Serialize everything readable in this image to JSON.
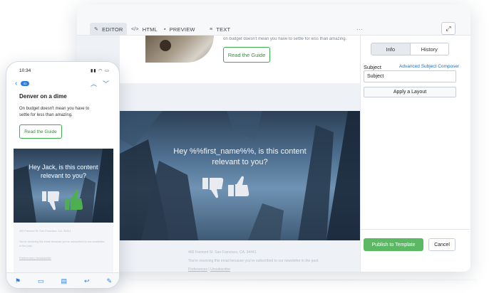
{
  "editor": {
    "tabs": [
      {
        "label": "EDITOR",
        "icon": "pencil-icon"
      },
      {
        "label": "HTML",
        "icon": "code-icon"
      },
      {
        "label": "PREVIEW",
        "icon": "page-icon"
      },
      {
        "label": "TEXT",
        "icon": "text-icon"
      }
    ],
    "active_tab": "EDITOR",
    "email": {
      "top_snippet": "on budget doesn't mean you have to settle for less than amazing.",
      "guide_button": "Read the Guide",
      "hero_text_line1": "Hey %%first_name%%, is this content",
      "hero_text_line2": "relevant to you?",
      "footer_address": "400 Fremont St. San Francisco, CA. 94441",
      "footer_notice": "You're receiving this email because you've subscribed to our newsletter in the past.",
      "footer_pref": "Preferences",
      "footer_sep": "|",
      "footer_unsub": "Unsubscribe"
    },
    "side": {
      "tab_info": "Info",
      "tab_history": "History",
      "subject_label": "Subject",
      "advanced_link": "Advanced Subject Composer",
      "subject_value": "Subject",
      "apply_layout": "Apply a Layout",
      "publish": "Publish to Template",
      "cancel": "Cancel"
    }
  },
  "phone": {
    "time": "10:34",
    "badge": "41",
    "title": "Denver on a dime",
    "body": "On budget doesn't mean you have to settle for less than amazing.",
    "guide_button": "Read the Guide",
    "hero_line1": "Hey Jack, is this content",
    "hero_line2": "relevant to you?",
    "footer_address": "400 Fremont St. San Francisco, CA. 94441",
    "footer_notice": "You're receiving this email because you've subscribed to our newsletter in the past.",
    "footer_links": "Preferences | Unsubscribe"
  },
  "colors": {
    "accent_green": "#5cb865",
    "link_blue": "#1b6fc9",
    "ios_blue": "#2a7de1"
  }
}
